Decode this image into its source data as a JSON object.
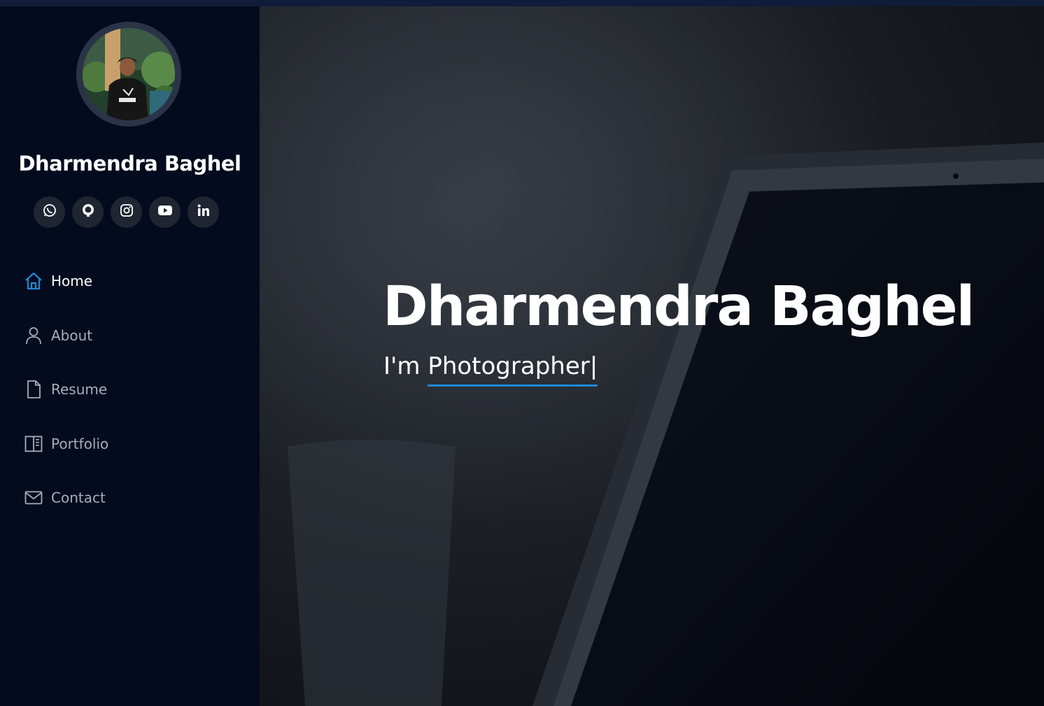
{
  "profile": {
    "name": "Dharmendra Baghel"
  },
  "social": [
    {
      "icon": "whatsapp-icon"
    },
    {
      "icon": "github-icon"
    },
    {
      "icon": "instagram-icon"
    },
    {
      "icon": "youtube-icon"
    },
    {
      "icon": "linkedin-icon"
    }
  ],
  "nav": {
    "items": [
      {
        "label": "Home",
        "icon": "home-icon",
        "active": true
      },
      {
        "label": "About",
        "icon": "person-icon",
        "active": false
      },
      {
        "label": "Resume",
        "icon": "file-icon",
        "active": false
      },
      {
        "label": "Portfolio",
        "icon": "columns-icon",
        "active": false
      },
      {
        "label": "Contact",
        "icon": "envelope-icon",
        "active": false
      }
    ]
  },
  "hero": {
    "title": "Dharmendra Baghel",
    "prefix": "I'm ",
    "typed": "Photographer|"
  },
  "colors": {
    "accent": "#1e88d6",
    "sidebar_bg": "#040b1e",
    "social_bg": "#1f2531"
  }
}
